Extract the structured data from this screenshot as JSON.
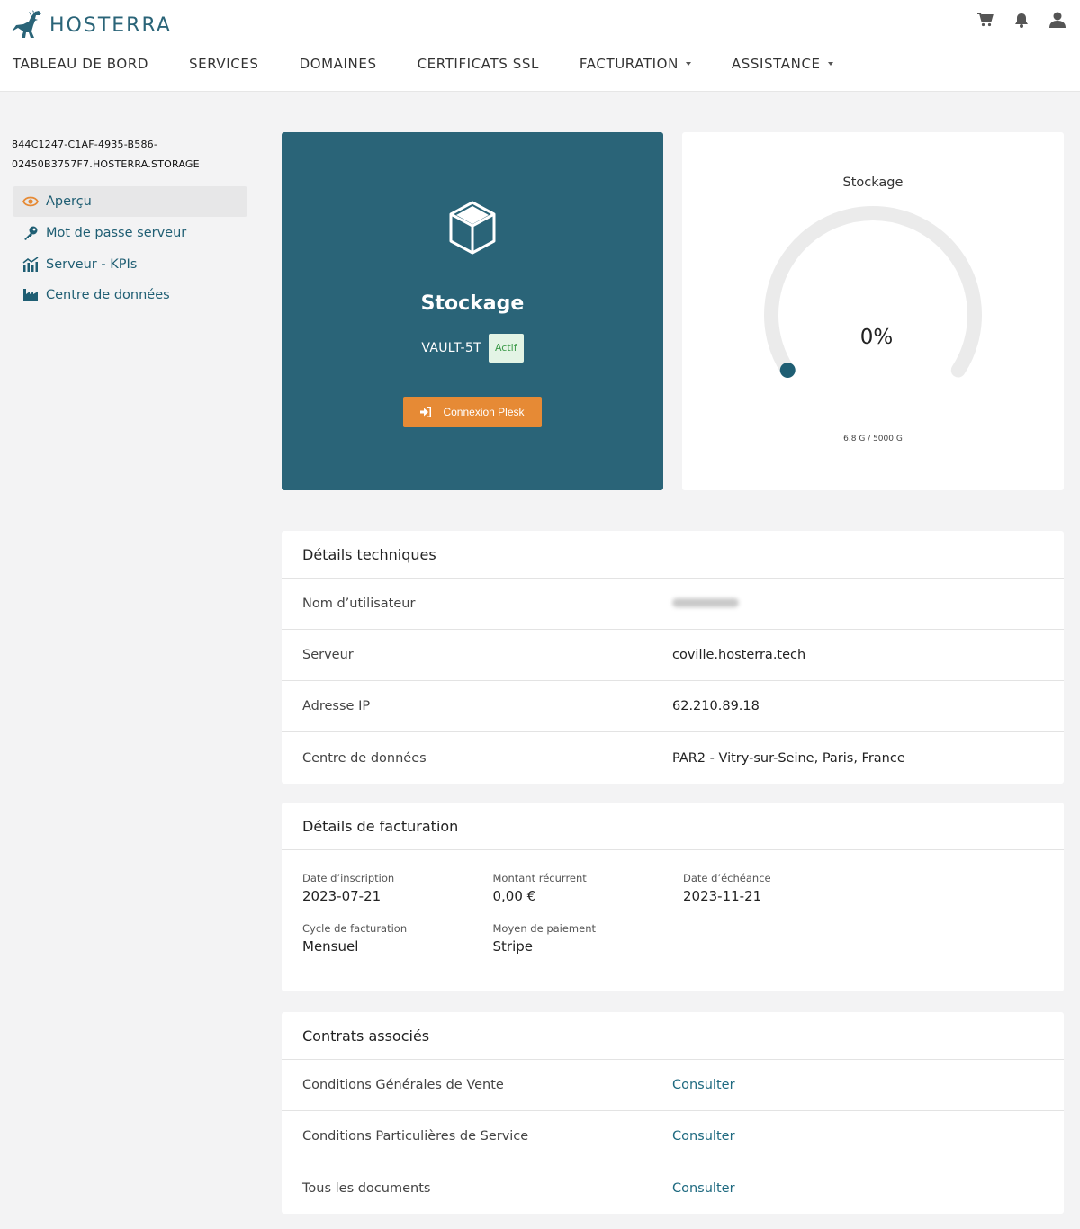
{
  "brand": {
    "name": "HOSTERRA",
    "color": "#2a6478"
  },
  "header": {
    "icons": [
      "cart-icon",
      "bell-icon",
      "user-icon"
    ],
    "nav": [
      {
        "label": "TABLEAU DE BORD",
        "dropdown": false
      },
      {
        "label": "SERVICES",
        "dropdown": false
      },
      {
        "label": "DOMAINES",
        "dropdown": false
      },
      {
        "label": "CERTIFICATS SSL",
        "dropdown": false
      },
      {
        "label": "FACTURATION",
        "dropdown": true
      },
      {
        "label": "ASSISTANCE",
        "dropdown": true
      }
    ]
  },
  "sidebar": {
    "service_id_line1": "844C1247-C1AF-4935-B586-",
    "service_id_line2": "02450B3757F7.HOSTERRA.STORAGE",
    "items": [
      {
        "label": "Aperçu",
        "icon": "eye-icon",
        "active": true
      },
      {
        "label": "Mot de passe serveur",
        "icon": "key-icon",
        "active": false
      },
      {
        "label": "Serveur - KPIs",
        "icon": "chart-icon",
        "active": false
      },
      {
        "label": "Centre de données",
        "icon": "factory-icon",
        "active": false
      }
    ]
  },
  "hero": {
    "title": "Stockage",
    "plan": "VAULT-5T",
    "status": "Actif",
    "button": "Connexion Plesk",
    "bg_color": "#2a6478",
    "button_color": "#e68a35"
  },
  "gauge": {
    "title": "Stockage",
    "value_label": "0%",
    "fraction": 0.0,
    "usage": "6.8 G / 5000 G"
  },
  "tech": {
    "title": "Détails techniques",
    "rows": [
      {
        "label": "Nom d’utilisateur",
        "value": ""
      },
      {
        "label": "Serveur",
        "value": "coville.hosterra.tech"
      },
      {
        "label": "Adresse IP",
        "value": "62.210.89.18"
      },
      {
        "label": "Centre de données",
        "value": "PAR2 - Vitry-sur-Seine, Paris, France"
      }
    ]
  },
  "billing": {
    "title": "Détails de facturation",
    "fields": [
      {
        "label": "Date d’inscription",
        "value": "2023-07-21"
      },
      {
        "label": "Montant récurrent",
        "value": "0,00 €"
      },
      {
        "label": "Date d’échéance",
        "value": "2023-11-21"
      },
      {
        "label": "Cycle de facturation",
        "value": "Mensuel"
      },
      {
        "label": "Moyen de paiement",
        "value": "Stripe"
      }
    ]
  },
  "contracts": {
    "title": "Contrats associés",
    "rows": [
      {
        "label": "Conditions Générales de Vente",
        "link": "Consulter"
      },
      {
        "label": "Conditions Particulières de Service",
        "link": "Consulter"
      },
      {
        "label": "Tous les documents",
        "link": "Consulter"
      }
    ]
  }
}
